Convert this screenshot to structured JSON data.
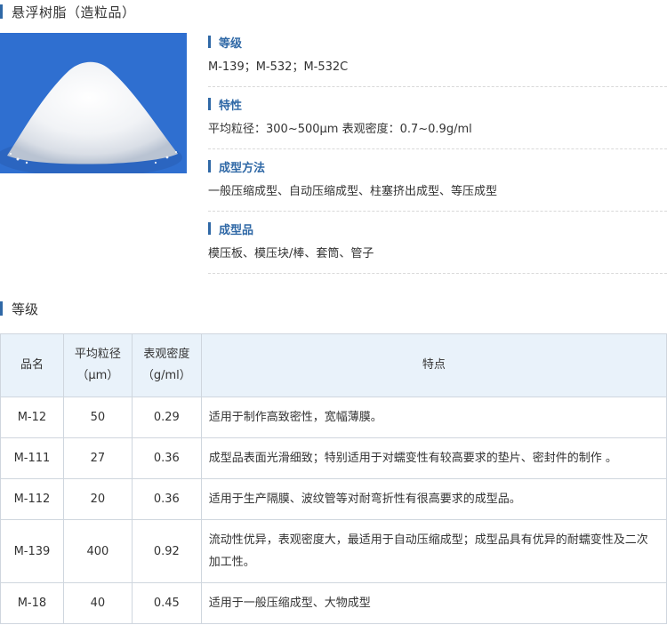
{
  "page_title": "悬浮树脂（造粒品）",
  "specs": [
    {
      "label": "等级",
      "value": "M-139；M-532；M-532C"
    },
    {
      "label": "特性",
      "value": "平均粒径：300~500μm 表观密度：0.7~0.9g/ml"
    },
    {
      "label": "成型方法",
      "value": "一般压缩成型、自动压缩成型、柱塞挤出成型、等压成型"
    },
    {
      "label": "成型品",
      "value": "模压板、模压块/棒、套筒、管子"
    }
  ],
  "section_title": "等级",
  "table": {
    "headers": {
      "grade": "品名",
      "size_line1": "平均粒径",
      "size_line2": "（μm）",
      "density_line1": "表观密度",
      "density_line2": "（g/ml）",
      "feature": "特点"
    },
    "rows": [
      {
        "grade": "M-12",
        "size": "50",
        "density": "0.29",
        "feature": "适用于制作高致密性，宽幅薄膜。"
      },
      {
        "grade": "M-111",
        "size": "27",
        "density": "0.36",
        "feature": "成型品表面光滑细致；特别适用于对蠕变性有较高要求的垫片、密封件的制作 。"
      },
      {
        "grade": "M-112",
        "size": "20",
        "density": "0.36",
        "feature": "适用于生产隔膜、波纹管等对耐弯折性有很高要求的成型品。"
      },
      {
        "grade": "M-139",
        "size": "400",
        "density": "0.92",
        "feature": "流动性优异，表观密度大，最适用于自动压缩成型；成型品具有优异的耐蠕变性及二次加工性。"
      },
      {
        "grade": "M-18",
        "size": "40",
        "density": "0.45",
        "feature": "适用于一般压缩成型、大物成型"
      }
    ]
  },
  "colors": {
    "accent": "#2f68a6",
    "header_bg": "#e9f2fa",
    "border": "#cfd6de"
  }
}
